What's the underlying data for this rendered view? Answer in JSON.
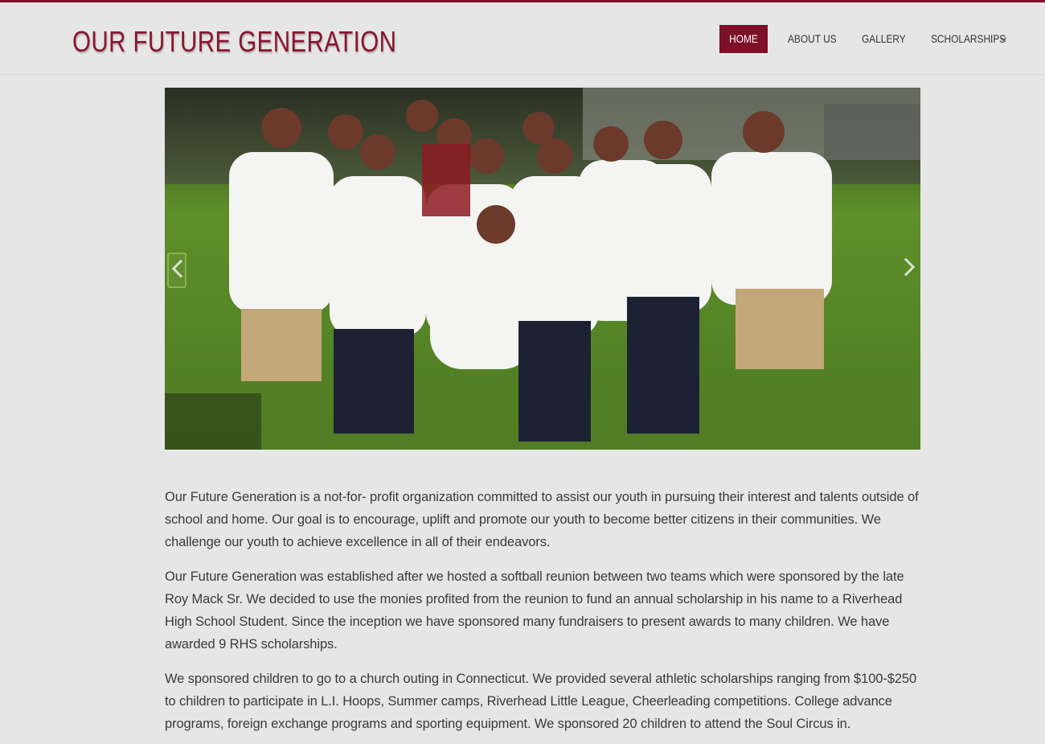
{
  "site": {
    "title": "OUR FUTURE GENERATION",
    "accent": "#7d0f26",
    "title_color": "#8a1530"
  },
  "nav": {
    "items": [
      {
        "label": "HOME",
        "active": true
      },
      {
        "label": "ABOUT US"
      },
      {
        "label": "GALLERY"
      },
      {
        "label": "SCHOLARSHIPS",
        "icon": "chevron-down-icon"
      }
    ]
  },
  "slider": {
    "prev_icon": "chevron-left-icon",
    "next_icon": "chevron-right-icon"
  },
  "content": {
    "paragraphs": [
      "Our Future Generation is a not-for- profit organization committed to assist our youth in pursuing their interest and talents outside of school and home. Our goal is to encourage, uplift and promote our youth to become better citizens in their communities. We challenge our youth to achieve excellence in all of their endeavors.",
      "Our Future Generation was established after we hosted a softball reunion between two teams which were sponsored by the late Roy Mack Sr. We decided to use the monies profited from the reunion to fund an annual scholarship in his name to a Riverhead High School Student. Since the inception we have sponsored many fundraisers to present awards to many children. We have awarded 9 RHS scholarships.",
      "We sponsored children to go to a church outing in Connecticut. We provided several athletic scholarships ranging from $100-$250 to children to participate in L.I. Hoops, Summer camps, Riverhead Little League, Cheerleading competitions. College advance programs, foreign exchange programs and sporting equipment. We sponsored 20 children to attend the Soul Circus in."
    ]
  }
}
